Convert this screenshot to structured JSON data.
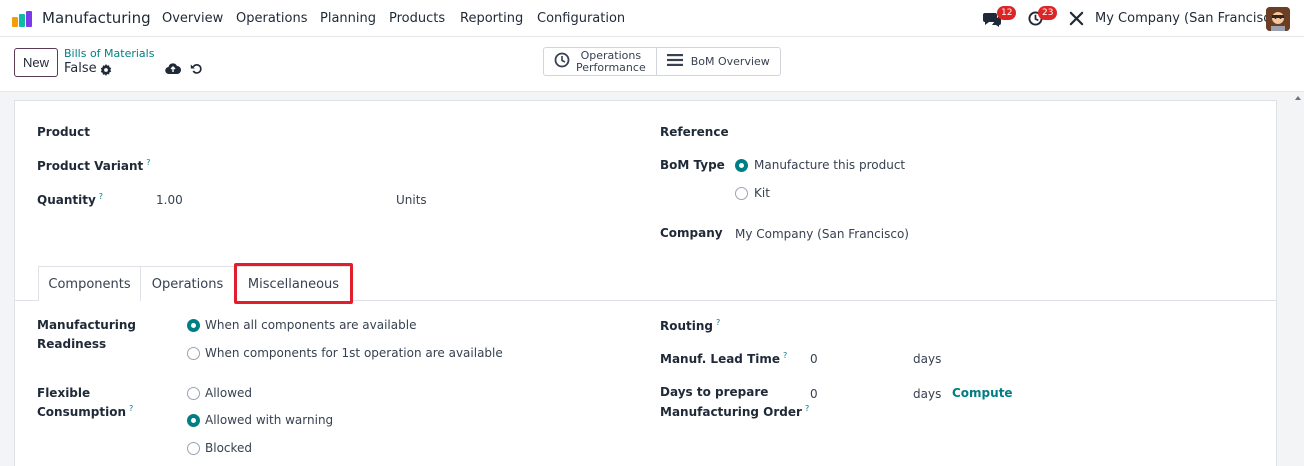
{
  "nav": {
    "app_name": "Manufacturing",
    "menus": [
      "Overview",
      "Operations",
      "Planning",
      "Products",
      "Reporting",
      "Configuration"
    ],
    "messages_badge": "12",
    "activities_badge": "23",
    "company": "My Company (San Francisco)",
    "icons": {
      "messages": "chat-icon",
      "activities": "clock-icon",
      "debug": "tools-icon"
    }
  },
  "control_panel": {
    "new_label": "New",
    "breadcrumb": "Bills of Materials",
    "record_name": "False",
    "smart_buttons": [
      {
        "line1": "Operations",
        "line2": "Performance",
        "icon": "clock-icon"
      },
      {
        "label": "BoM Overview",
        "icon": "list-icon"
      }
    ]
  },
  "form": {
    "product_label": "Product",
    "product_variant_label": "Product Variant",
    "quantity_label": "Quantity",
    "quantity_value": "1.00",
    "quantity_uom": "Units",
    "reference_label": "Reference",
    "bom_type_label": "BoM Type",
    "bom_type_options": [
      "Manufacture this product",
      "Kit"
    ],
    "bom_type_selected": "Manufacture this product",
    "company_label": "Company",
    "company_value": "My Company (San Francisco)"
  },
  "tabs": [
    "Components",
    "Operations",
    "Miscellaneous"
  ],
  "active_tab": "Miscellaneous",
  "misc": {
    "readiness_label_1": "Manufacturing",
    "readiness_label_2": "Readiness",
    "readiness_options": [
      "When all components are available",
      "When components for 1st operation are available"
    ],
    "readiness_selected": "When all components are available",
    "consumption_label_1": "Flexible",
    "consumption_label_2": "Consumption",
    "consumption_options": [
      "Allowed",
      "Allowed with warning",
      "Blocked"
    ],
    "consumption_selected": "Allowed with warning",
    "routing_label": "Routing",
    "lead_time_label": "Manuf. Lead Time",
    "lead_time_value": "0",
    "lead_time_unit": "days",
    "prepare_label_1": "Days to prepare",
    "prepare_label_2": "Manufacturing Order",
    "prepare_value": "0",
    "prepare_unit": "days",
    "compute_label": "Compute"
  },
  "help_marker": "?",
  "colors": {
    "accent": "#017e84",
    "highlight": "#e11d2e",
    "brand": "#714b67",
    "badge": "#dc2626"
  }
}
